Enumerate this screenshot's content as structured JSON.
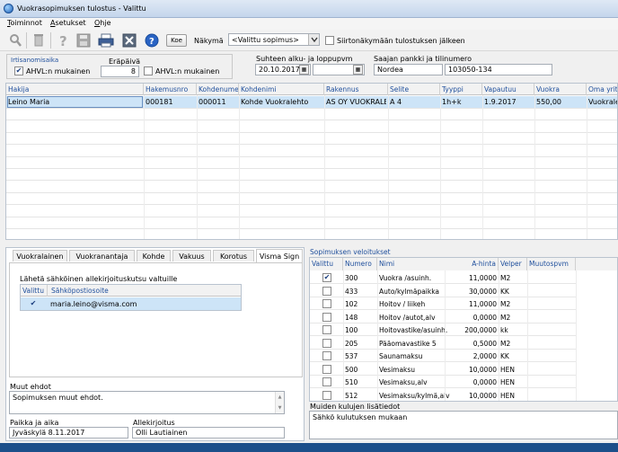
{
  "window": {
    "title": "Vuokrasopimuksen tulostus - Valittu"
  },
  "menu": [
    "Toiminnot",
    "Asetukset",
    "Ohje"
  ],
  "toolbar": {
    "koe_label": "Koe",
    "nakyma_label": "Näkymä",
    "nakyma_value": "<Valittu sopimus>",
    "siirto_label": "Siirtonäkymään tulostuksen jälkeen"
  },
  "filters": {
    "irtisanomisaika_label": "Irtisanomisaika",
    "ahvl_label": "AHVL:n mukainen",
    "erapaiva_label": "Eräpäivä",
    "erapaiva_value": "8",
    "ahvl2_label": "AHVL:n mukainen",
    "period_label": "Suhteen alku- ja loppupvm",
    "period_start": "20.10.2017",
    "period_end": "",
    "bank_label": "Saajan pankki ja tilinumero",
    "bank_name": "Nordea",
    "bank_account": "103050-134"
  },
  "main_grid": {
    "headers": [
      "Hakija",
      "Hakemusnro",
      "Kohdenume",
      "Kohdenimi",
      "Rakennus",
      "Selite",
      "Tyyppi",
      "Vapautuu",
      "Vuokra",
      "Oma yrit"
    ],
    "rows": [
      [
        "Leino Maria",
        "000181",
        "000011",
        "Kohde Vuokralehto",
        "AS OY VUOKRALE",
        "A 4",
        "1h+k",
        "1.9.2017",
        "550,00",
        "Vuokrale"
      ]
    ]
  },
  "tabs": [
    "Vuokralainen",
    "Vuokranantaja",
    "Kohde",
    "Vakuus",
    "Korotus",
    "Visma Sign"
  ],
  "visma_sign": {
    "send_label": "Lähetä sähköinen allekirjoituskutsu valtuille",
    "headers": [
      "Valittu",
      "Sähköpostiosoite"
    ],
    "rows": [
      {
        "email": "maria.leino@visma.com"
      }
    ]
  },
  "terms": {
    "label": "Muut ehdot",
    "value": "Sopimuksen muut ehdot.",
    "place_label": "Paikka ja aika",
    "place_value": "Jyväskylä  8.11.2017",
    "signature_label": "Allekirjoitus",
    "signature_value": "Olli Lautiainen"
  },
  "charges": {
    "label": "Sopimuksen veloitukset",
    "headers": [
      "Valittu",
      "Numero",
      "Nimi",
      "A-hinta",
      "Velper",
      "Muutospvm"
    ],
    "rows": [
      {
        "checked": true,
        "num": "300",
        "name": "Vuokra /asuinh.",
        "price": "11,0000",
        "unit": "M2"
      },
      {
        "checked": false,
        "num": "433",
        "name": "Auto/kylmäpaikka",
        "price": "30,0000",
        "unit": "KK"
      },
      {
        "checked": false,
        "num": "102",
        "name": "Hoitov / liikeh",
        "price": "11,0000",
        "unit": "M2"
      },
      {
        "checked": false,
        "num": "148",
        "name": "Hoitov /autot,alv",
        "price": "0,0000",
        "unit": "M2"
      },
      {
        "checked": false,
        "num": "100",
        "name": "Hoitovastike/asuinh.",
        "price": "200,0000",
        "unit": "kk"
      },
      {
        "checked": false,
        "num": "205",
        "name": "Pääomavastike 5",
        "price": "0,5000",
        "unit": "M2"
      },
      {
        "checked": false,
        "num": "537",
        "name": "Saunamaksu",
        "price": "2,0000",
        "unit": "KK"
      },
      {
        "checked": false,
        "num": "500",
        "name": "Vesimaksu",
        "price": "10,0000",
        "unit": "HEN"
      },
      {
        "checked": false,
        "num": "510",
        "name": "Vesimaksu,alv",
        "price": "0,0000",
        "unit": "HEN"
      },
      {
        "checked": false,
        "num": "512",
        "name": "Vesimaksu/kylmä,alv",
        "price": "10,0000",
        "unit": "HEN"
      }
    ],
    "extra_label": "Muiden kulujen lisätiedot",
    "extra_value": "Sähkö kulutuksen mukaan"
  }
}
